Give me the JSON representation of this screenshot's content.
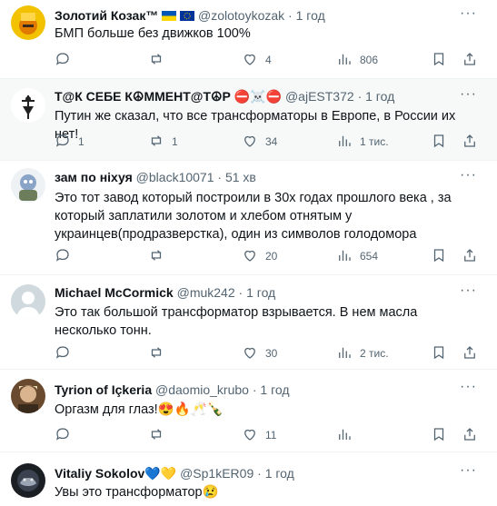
{
  "tweets": [
    {
      "name": "Золотий Козак™",
      "handle": "@zolotoykozak",
      "sep": "·",
      "time": "1 год",
      "text": "БМП больше без движков 100%",
      "replies": "",
      "retweets": "",
      "likes": "4",
      "views": "806"
    },
    {
      "name": "Т@К СЕБЕ К☮ММЕНТ@Т☮Р ⛔☠️⛔",
      "handle": "@ajEST372",
      "sep": "·",
      "time": "1 год",
      "text": "Путин же сказал, что все трансформаторы в Европе, в России их нет!",
      "replies": "1",
      "retweets": "1",
      "likes": "34",
      "views": "1 тис."
    },
    {
      "name": "зам по ніхуя",
      "handle": "@black10071",
      "sep": "·",
      "time": "51 хв",
      "text": "Это тот завод который построили в 30х годах прошлого века , за который заплатили золотом и хлебом отнятым у украинцев(продразверстка), один из символов голодомора",
      "replies": "",
      "retweets": "",
      "likes": "20",
      "views": "654"
    },
    {
      "name": "Michael McCormick",
      "handle": "@muk242",
      "sep": "·",
      "time": "1 год",
      "text": "Это так большой трансформатор взрывается. В нем масла несколько тонн.",
      "replies": "",
      "retweets": "",
      "likes": "30",
      "views": "2 тис."
    },
    {
      "name": "Tyrion of Içkeria",
      "handle": "@daomio_krubo",
      "sep": "·",
      "time": "1 год",
      "text": "Оргазм для глаз!😍🔥🥂🍾",
      "replies": "",
      "retweets": "",
      "likes": "11",
      "views": ""
    },
    {
      "name": "Vitaliy Sokolov💙💛",
      "handle": "@Sp1kER09",
      "sep": "·",
      "time": "1 год",
      "text": "Увы это трансформатор😢",
      "replies": "",
      "retweets": "",
      "likes": "",
      "views": ""
    }
  ],
  "more_label": "···",
  "colors": {
    "text": "#0f1419",
    "secondary": "#536471",
    "border": "#eff3f4",
    "highlight_bg": "#f7f9f9"
  }
}
